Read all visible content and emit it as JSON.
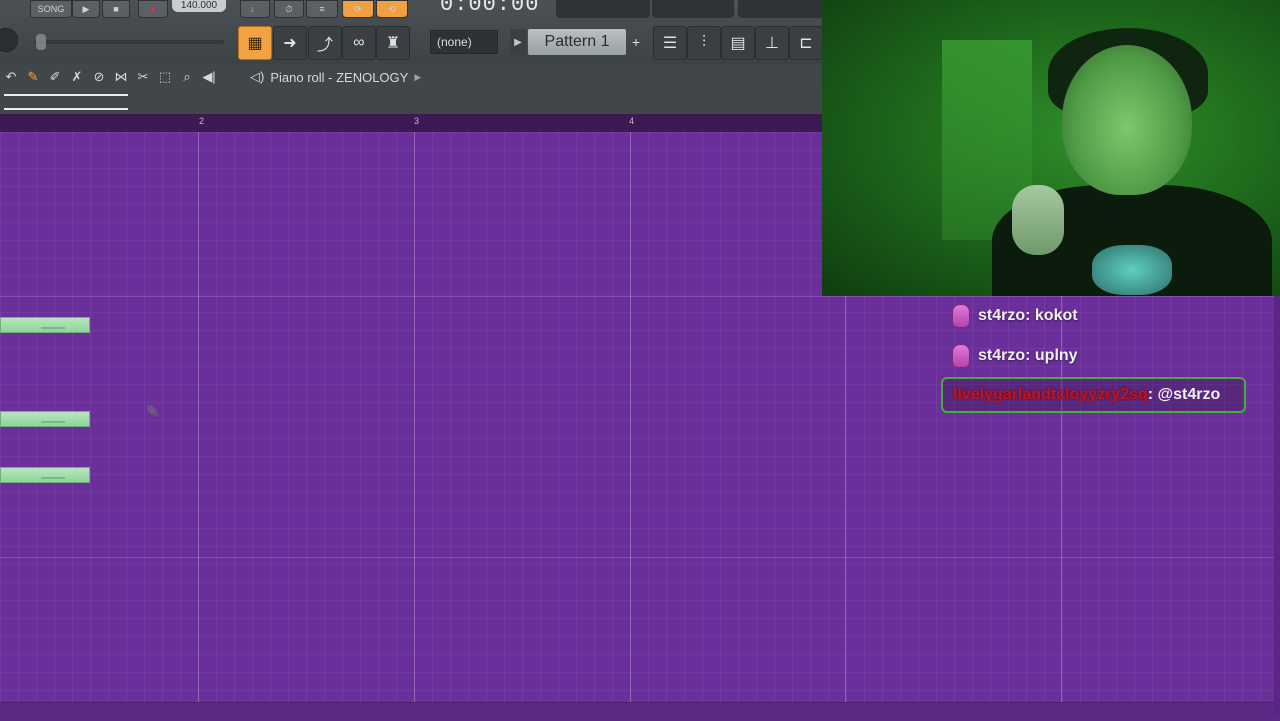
{
  "toolbar": {
    "song_label": "SONG",
    "tempo": "140.000",
    "time": "0:00:00",
    "pattern_select": "(none)",
    "pattern_name": "Pattern 1",
    "pattern_plus": "+"
  },
  "piano_roll": {
    "title": "Piano roll - ZENOLOGY",
    "ruler": [
      "2",
      "3",
      "4"
    ]
  },
  "chat": {
    "messages": [
      {
        "user": "st4rzo",
        "text": "kokot"
      },
      {
        "user": "st4rzo",
        "text": "uplny"
      }
    ],
    "highlight": {
      "user": "llvelygarlandtcloyyzry2sq",
      "text": "@st4rzo"
    }
  },
  "colors": {
    "grid": "#6b2f9c",
    "note": "#a8ddb0",
    "accent_orange": "#f3a243",
    "chat_highlight_border": "#44ad3c"
  }
}
